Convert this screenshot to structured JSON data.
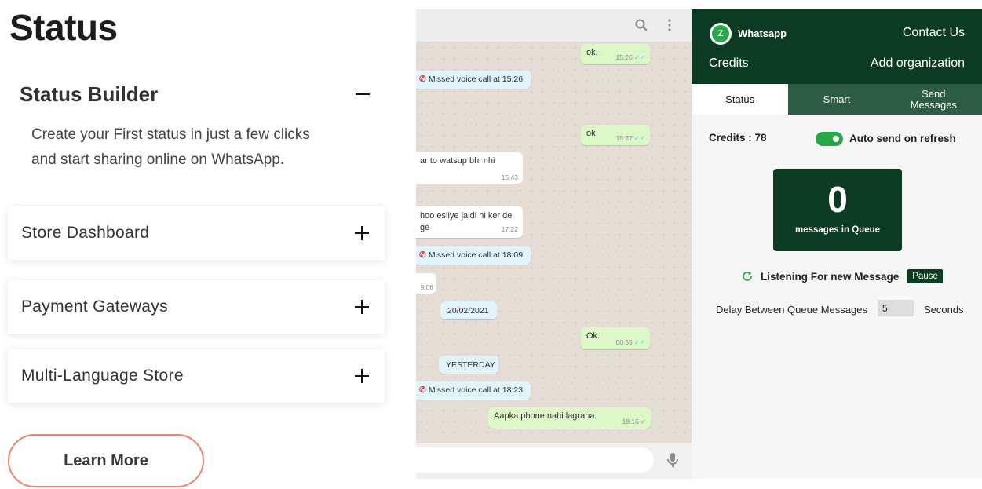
{
  "left": {
    "title": "Status",
    "open_section": {
      "title": "Status Builder",
      "body_line1": "Create your First status in just a few clicks",
      "body_line2": "and start sharing online on WhatsApp."
    },
    "sections": [
      {
        "title": "Store Dashboard"
      },
      {
        "title": "Payment Gateways"
      },
      {
        "title": "Multi-Language Store"
      }
    ],
    "learn_more": "Learn More"
  },
  "chat": {
    "messages": [
      {
        "text": "ok.",
        "time": "15:26",
        "ticks": "✓✓"
      },
      {
        "text": "Missed voice call at 15:26"
      },
      {
        "text": "ok",
        "time": "15:27",
        "ticks": "✓✓"
      },
      {
        "text": "ar to watsup bhi nhi",
        "time": "15:43"
      },
      {
        "text_line1": "hoo esliye jaldi hi ker de",
        "text_line2": "ge",
        "time": "17:22"
      },
      {
        "text": "Missed voice call at 18:09"
      },
      {
        "time": "9:06"
      },
      {
        "text": "20/02/2021"
      },
      {
        "text": "Ok.",
        "time": "00:55",
        "ticks": "✓✓"
      },
      {
        "text": "YESTERDAY"
      },
      {
        "text": "Missed voice call at 18:23"
      },
      {
        "text": "Aapka phone nahi lagraha",
        "time": "19:16",
        "ticks": "✓"
      }
    ]
  },
  "extension": {
    "logo_letter": "Z",
    "logo_text": "Whatsapp",
    "contact_us": "Contact Us",
    "credits_link": "Credits",
    "add_org": "Add organization",
    "tabs": {
      "status": "Status",
      "smart": "Smart",
      "send_line1": "Send",
      "send_line2": "Messages"
    },
    "credits_text": "Credits : 78",
    "auto_send": "Auto send on refresh",
    "queue_count": "0",
    "queue_label": "messages in Queue",
    "listening": "Listening For new Message",
    "pause": "Pause",
    "delay_label": "Delay Between Queue Messages",
    "delay_value": "5",
    "seconds": "Seconds"
  },
  "colors": {
    "brand_dark": "#0c3b23",
    "accent_green": "#29a84a",
    "learn_more_border": "#f08070"
  }
}
